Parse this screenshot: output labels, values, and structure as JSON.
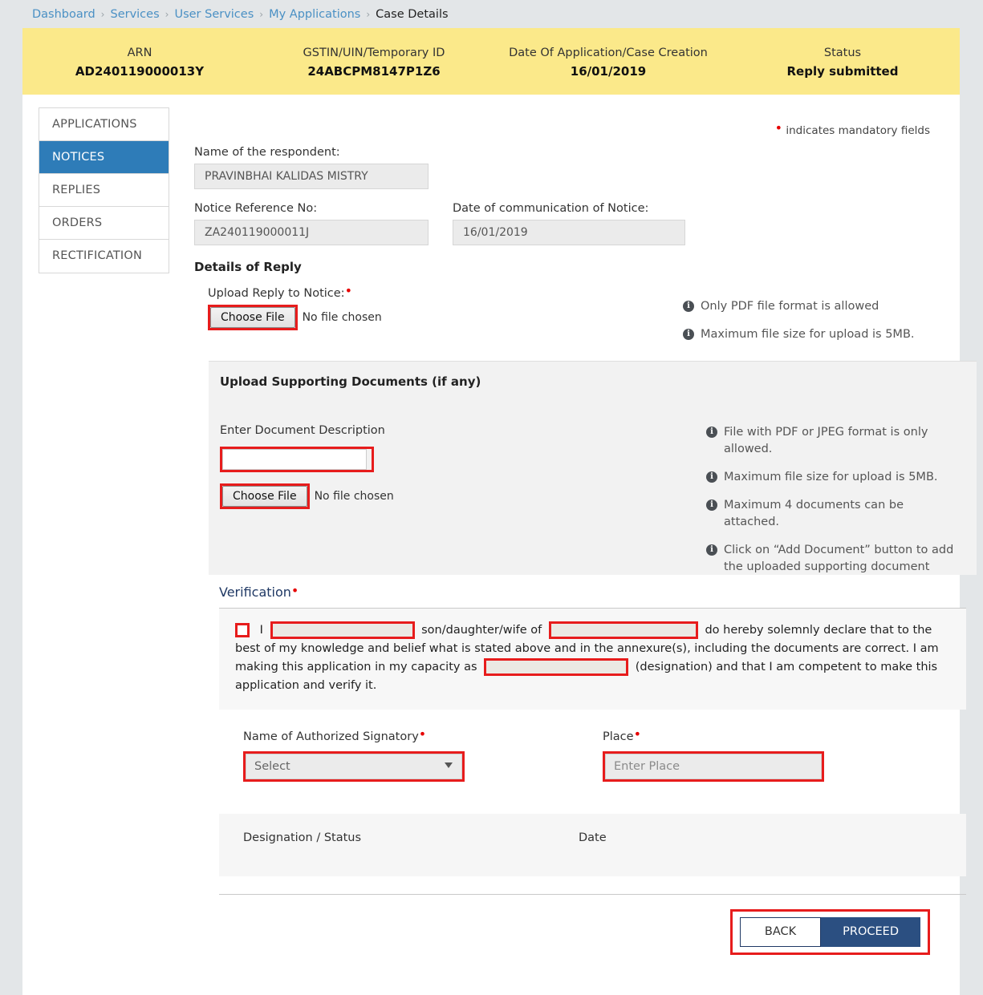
{
  "breadcrumb": {
    "items": [
      {
        "label": "Dashboard",
        "current": false
      },
      {
        "label": "Services",
        "current": false
      },
      {
        "label": "User Services",
        "current": false
      },
      {
        "label": "My Applications",
        "current": false
      },
      {
        "label": "Case Details",
        "current": true
      }
    ],
    "separator": "›"
  },
  "banner": {
    "bg_color": "#fbe98a",
    "cells": [
      {
        "label": "ARN",
        "value": "AD240119000013Y"
      },
      {
        "label": "GSTIN/UIN/Temporary ID",
        "value": "24ABCPM8147P1Z6"
      },
      {
        "label": "Date Of Application/Case Creation",
        "value": "16/01/2019"
      },
      {
        "label": "Status",
        "value": "Reply submitted"
      }
    ]
  },
  "sidebar": {
    "items": [
      {
        "label": "APPLICATIONS",
        "active": false
      },
      {
        "label": "NOTICES",
        "active": true
      },
      {
        "label": "REPLIES",
        "active": false
      },
      {
        "label": "ORDERS",
        "active": false
      },
      {
        "label": "RECTIFICATION",
        "active": false
      }
    ],
    "active_color": "#2e7cb8"
  },
  "form": {
    "mandatory_note": "indicates mandatory fields",
    "mandatory_color": "#e60000",
    "respondent_label": "Name of the respondent:",
    "respondent_value": "PRAVINBHAI KALIDAS MISTRY",
    "notice_ref_label": "Notice Reference No:",
    "notice_ref_value": "ZA240119000011J",
    "notice_date_label": "Date of communication of Notice:",
    "notice_date_value": "16/01/2019",
    "details_of_reply_heading": "Details of Reply",
    "upload_reply_label": "Upload Reply to Notice:",
    "choose_file_label": "Choose File",
    "no_file_chosen": "No file chosen",
    "reply_notes": [
      "Only PDF file format is allowed",
      "Maximum file size for upload is 5MB."
    ]
  },
  "supporting": {
    "heading": "Upload Supporting Documents (if any)",
    "description_label": "Enter Document Description",
    "description_value": "",
    "choose_file_label": "Choose File",
    "no_file_chosen": "No file chosen",
    "notes": [
      "File with PDF or JPEG format is only allowed.",
      "Maximum file size for upload is 5MB.",
      "Maximum 4 documents can be attached.",
      "Click on “Add Document” button to add the uploaded supporting document"
    ]
  },
  "verification": {
    "title": "Verification",
    "text_1": "I",
    "field_1_value": "",
    "text_2": "son/daughter/wife of",
    "field_2_value": "",
    "text_3": "do hereby solemnly declare that to the best of my knowledge and belief what is stated above and in the annexure(s), including the documents are correct. I am making this application in my capacity as",
    "field_3_value": "",
    "text_4": "(designation) and that I am competent to make this application and verify it.",
    "checkbox_checked": false,
    "signatory_label": "Name of Authorized Signatory",
    "signatory_selected": "Select",
    "signatory_options": [
      "Select"
    ],
    "place_label": "Place",
    "place_value": "",
    "place_placeholder": "Enter Place",
    "designation_label": "Designation / Status",
    "designation_value": "",
    "date_label": "Date",
    "date_value": ""
  },
  "actions": {
    "back_label": "BACK",
    "proceed_label": "PROCEED",
    "proceed_color": "#2b4f81",
    "highlight_color": "#e71c1c"
  }
}
